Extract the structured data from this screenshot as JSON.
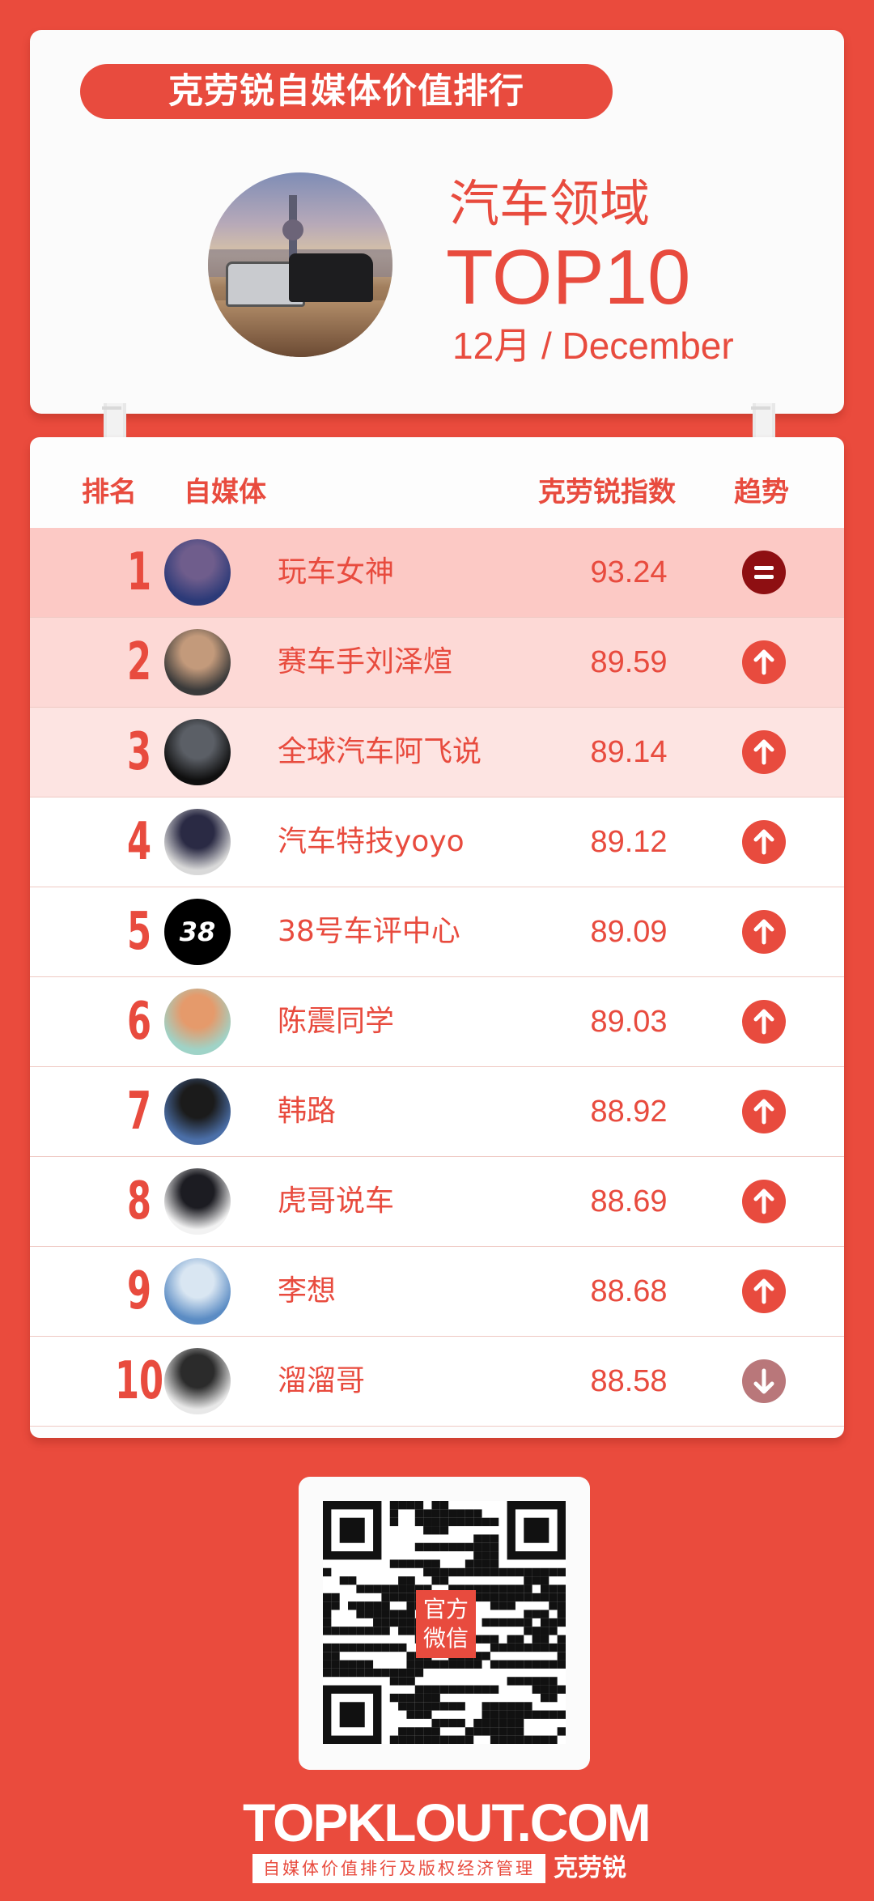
{
  "header": {
    "banner": "克劳锐自媒体价值排行",
    "category": "汽车领域",
    "top": "TOP10",
    "month": "12月 / December"
  },
  "table": {
    "columns": {
      "rank": "排名",
      "media": "自媒体",
      "index": "克劳锐指数",
      "trend": "趋势"
    },
    "rows": [
      {
        "rank": "1",
        "name": "玩车女神",
        "score": "93.24",
        "trend": "same",
        "bg": "#fcc9c5",
        "avatar": [
          "#2c3a78",
          "#6f5d8c"
        ]
      },
      {
        "rank": "2",
        "name": "赛车手刘泽煊",
        "score": "89.59",
        "trend": "up",
        "bg": "#fdd9d6",
        "avatar": [
          "#3a3a3a",
          "#c39a7b"
        ]
      },
      {
        "rank": "3",
        "name": "全球汽车阿飞说",
        "score": "89.14",
        "trend": "up",
        "bg": "#fde4e2",
        "avatar": [
          "#0f0f0f",
          "#5b5f66"
        ]
      },
      {
        "rank": "4",
        "name": "汽车特技yoyo",
        "score": "89.12",
        "trend": "up",
        "bg": "#ffffff",
        "avatar": [
          "#d9d9d9",
          "#2a2a44"
        ]
      },
      {
        "rank": "5",
        "name": "38号车评中心",
        "score": "89.09",
        "trend": "up",
        "bg": "#ffffff",
        "avatar": [
          "#000000",
          "#000000"
        ],
        "avatar_text": "38"
      },
      {
        "rank": "6",
        "name": "陈震同学",
        "score": "89.03",
        "trend": "up",
        "bg": "#ffffff",
        "avatar": [
          "#9fd3c7",
          "#e59a6b"
        ]
      },
      {
        "rank": "7",
        "name": "韩路",
        "score": "88.92",
        "trend": "up",
        "bg": "#ffffff",
        "avatar": [
          "#4b6fa8",
          "#1b1b1b"
        ]
      },
      {
        "rank": "8",
        "name": "虎哥说车",
        "score": "88.69",
        "trend": "up",
        "bg": "#ffffff",
        "avatar": [
          "#f2f2f2",
          "#1c1c22"
        ]
      },
      {
        "rank": "9",
        "name": "李想",
        "score": "88.68",
        "trend": "up",
        "bg": "#ffffff",
        "avatar": [
          "#5b8cc4",
          "#d9e6f2"
        ]
      },
      {
        "rank": "10",
        "name": "溜溜哥",
        "score": "88.58",
        "trend": "down",
        "bg": "#ffffff",
        "avatar": [
          "#e8e8e8",
          "#2b2b2b"
        ]
      }
    ]
  },
  "qr": {
    "badge": "官方微信"
  },
  "footer": {
    "brand": "TOPKLOUT.COM",
    "tagline": "自媒体价值排行及版权经济管理",
    "brand_cn": "克劳锐"
  },
  "colors": {
    "accent": "#e84b3e",
    "background": "#ea4b3d",
    "same": "#8e0f12",
    "down": "#b9777a"
  }
}
